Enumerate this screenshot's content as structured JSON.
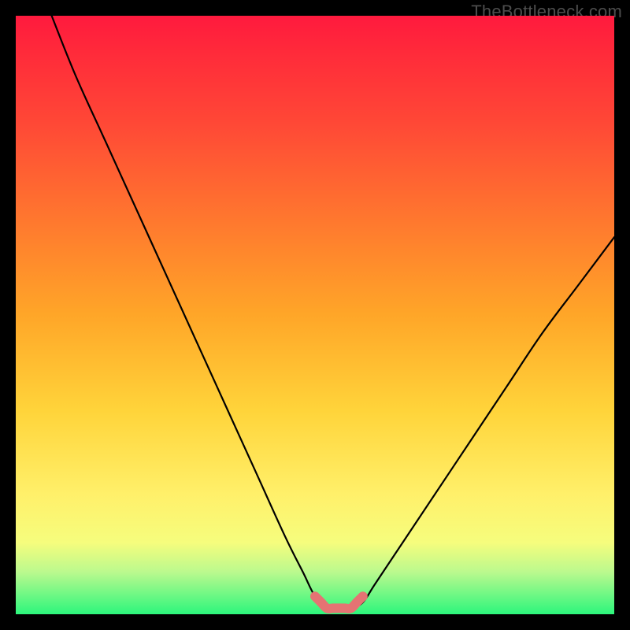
{
  "watermark": "TheBottleneck.com",
  "chart_data": {
    "type": "line",
    "title": "",
    "xlabel": "",
    "ylabel": "",
    "ylim": [
      0,
      100
    ],
    "xlim": [
      0,
      100
    ],
    "series": [
      {
        "name": "bottleneck-curve",
        "x": [
          6,
          10,
          15,
          20,
          25,
          30,
          35,
          40,
          45,
          48,
          50,
          52,
          54,
          56,
          58,
          60,
          64,
          70,
          76,
          82,
          88,
          94,
          100
        ],
        "values": [
          100,
          90,
          79,
          68,
          57,
          46,
          35,
          24,
          13,
          7,
          3,
          1,
          1,
          1,
          2,
          5,
          11,
          20,
          29,
          38,
          47,
          55,
          63
        ]
      },
      {
        "name": "optimal-range-marker",
        "x": [
          50,
          51,
          52,
          53,
          54,
          55,
          56,
          57,
          58
        ],
        "values": [
          3,
          2,
          1,
          1,
          1,
          1,
          1,
          2,
          3
        ]
      }
    ],
    "background_gradient": {
      "top_color": "#ff1a3e",
      "mid_color": "#ffd43a",
      "bottom_color": "#2cf67c"
    },
    "curve_color": "#000000",
    "marker_color": "#e57373"
  }
}
